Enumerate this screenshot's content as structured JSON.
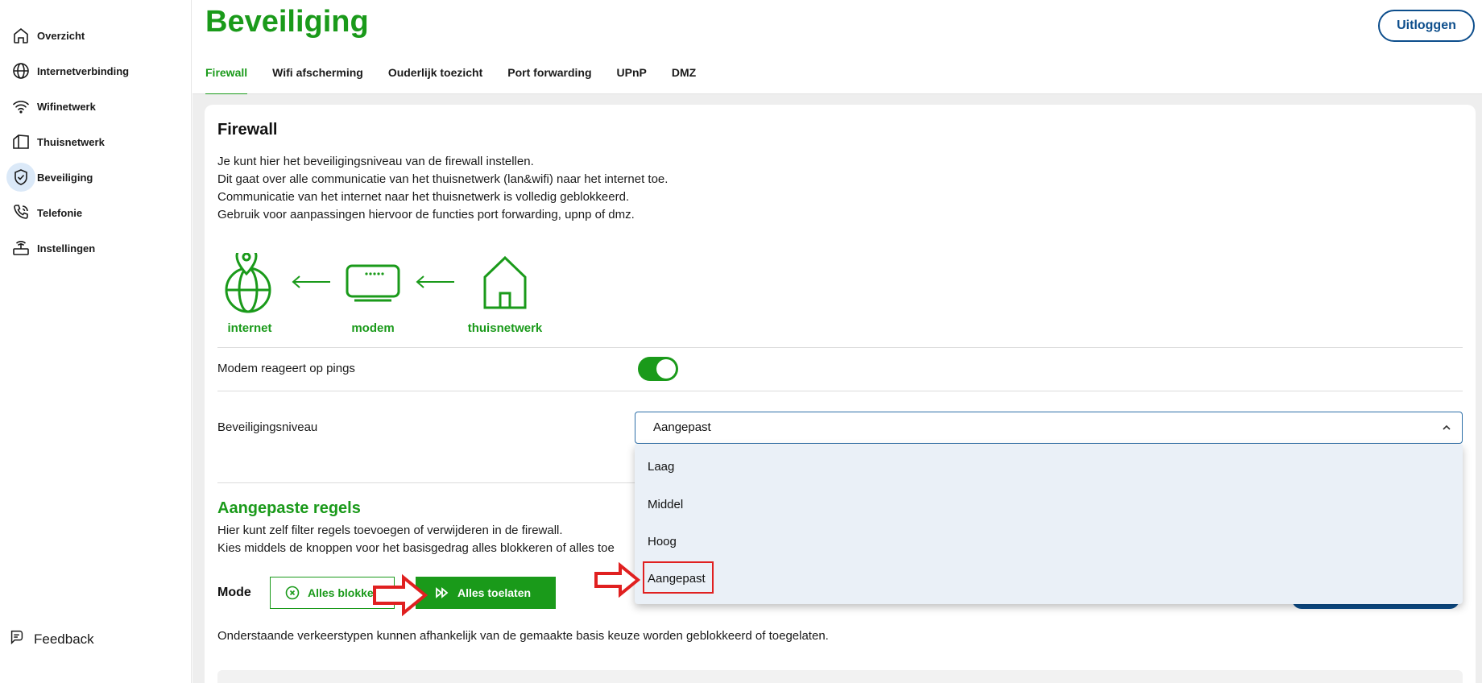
{
  "sidebar": {
    "items": [
      {
        "label": "Overzicht",
        "icon": "home-icon"
      },
      {
        "label": "Internetverbinding",
        "icon": "globe-icon"
      },
      {
        "label": "Wifinetwerk",
        "icon": "wifi-icon"
      },
      {
        "label": "Thuisnetwerk",
        "icon": "home-network-icon"
      },
      {
        "label": "Beveiliging",
        "icon": "shield-check-icon",
        "active": true
      },
      {
        "label": "Telefonie",
        "icon": "phone-icon"
      },
      {
        "label": "Instellingen",
        "icon": "router-settings-icon"
      }
    ],
    "feedback_label": "Feedback"
  },
  "header": {
    "title": "Beveiliging",
    "logout_label": "Uitloggen",
    "tabs": [
      {
        "label": "Firewall",
        "active": true
      },
      {
        "label": "Wifi afscherming"
      },
      {
        "label": "Ouderlijk toezicht"
      },
      {
        "label": "Port forwarding"
      },
      {
        "label": "UPnP"
      },
      {
        "label": "DMZ"
      }
    ]
  },
  "firewall": {
    "title": "Firewall",
    "description": [
      "Je kunt hier het beveiligingsniveau van de firewall instellen.",
      "Dit gaat over alle communicatie van het thuisnetwerk (lan&wifi) naar het internet toe.",
      "Communicatie van het internet naar het thuisnetwerk is volledig geblokkeerd.",
      "Gebruik voor aanpassingen hiervoor de functies port forwarding, upnp of dmz."
    ],
    "diagram": {
      "internet": "internet",
      "modem": "modem",
      "home": "thuisnetwerk"
    },
    "ping_label": "Modem reageert op pings",
    "ping_enabled": true,
    "level_label": "Beveiligingsniveau",
    "level_value": "Aangepast",
    "level_options": [
      "Laag",
      "Middel",
      "Hoog",
      "Aangepast"
    ]
  },
  "custom_rules": {
    "title": "Aangepaste regels",
    "description": [
      "Hier kunt zelf filter regels toevoegen of verwijderen in de firewall.",
      "Kies middels de knoppen voor het basisgedrag alles blokkeren of alles toe"
    ],
    "mode_label": "Mode",
    "block_all_label": "Alles blokkeren",
    "allow_all_label": "Alles toelaten",
    "footer_text": "Onderstaande verkeerstypen kunnen afhankelijk van de gemaakte basis keuze worden geblokkeerd of toegelaten."
  },
  "colors": {
    "brand_green": "#1a9a1a",
    "brand_blue": "#0d4e8c",
    "annotation_red": "#e02020"
  }
}
